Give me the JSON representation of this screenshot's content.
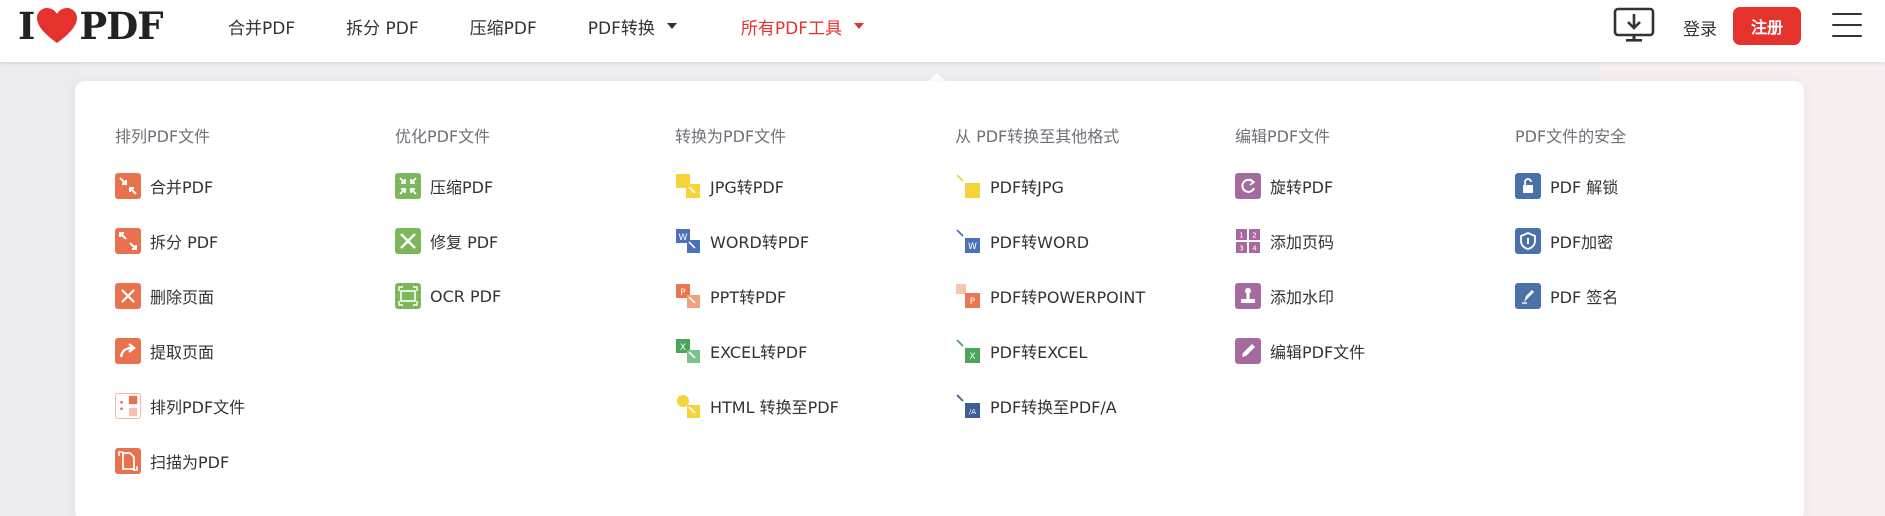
{
  "header": {
    "logo_left": "I",
    "logo_right": "PDF",
    "nav": [
      {
        "label": "合并PDF",
        "has_caret": false,
        "active": false
      },
      {
        "label": "拆分 PDF",
        "has_caret": false,
        "active": false
      },
      {
        "label": "压缩PDF",
        "has_caret": false,
        "active": false
      },
      {
        "label": "PDF转换",
        "has_caret": true,
        "active": false
      },
      {
        "label": "所有PDF工具",
        "has_caret": true,
        "active": true
      }
    ],
    "desktop_icon": "desktop-download-icon",
    "login": "登录",
    "signup": "注册",
    "menu_icon": "hamburger-icon"
  },
  "colors": {
    "accent": "#e5322d",
    "organize": "#e8724e",
    "optimize": "#7cb85b",
    "edit": "#a56a9e",
    "security": "#4b72a8"
  },
  "columns": [
    {
      "title": "排列PDF文件",
      "tools": [
        {
          "label": "合并PDF",
          "icon": "merge-icon"
        },
        {
          "label": "拆分 PDF",
          "icon": "split-icon"
        },
        {
          "label": "删除页面",
          "icon": "delete-pages-icon"
        },
        {
          "label": "提取页面",
          "icon": "extract-pages-icon"
        },
        {
          "label": "排列PDF文件",
          "icon": "organize-icon"
        },
        {
          "label": "扫描为PDF",
          "icon": "scan-icon"
        }
      ]
    },
    {
      "title": "优化PDF文件",
      "tools": [
        {
          "label": "压缩PDF",
          "icon": "compress-icon"
        },
        {
          "label": "修复 PDF",
          "icon": "repair-icon"
        },
        {
          "label": "OCR PDF",
          "icon": "ocr-icon"
        }
      ]
    },
    {
      "title": "转换为PDF文件",
      "tools": [
        {
          "label": "JPG转PDF",
          "icon": "jpg-to-pdf-icon"
        },
        {
          "label": "WORD转PDF",
          "icon": "word-to-pdf-icon"
        },
        {
          "label": "PPT转PDF",
          "icon": "ppt-to-pdf-icon"
        },
        {
          "label": "EXCEL转PDF",
          "icon": "excel-to-pdf-icon"
        },
        {
          "label": "HTML 转换至PDF",
          "icon": "html-to-pdf-icon"
        }
      ]
    },
    {
      "title": "从 PDF转换至其他格式",
      "tools": [
        {
          "label": "PDF转JPG",
          "icon": "pdf-to-jpg-icon"
        },
        {
          "label": "PDF转WORD",
          "icon": "pdf-to-word-icon"
        },
        {
          "label": "PDF转POWERPOINT",
          "icon": "pdf-to-ppt-icon"
        },
        {
          "label": "PDF转EXCEL",
          "icon": "pdf-to-excel-icon"
        },
        {
          "label": "PDF转换至PDF/A",
          "icon": "pdf-to-pdfa-icon"
        }
      ]
    },
    {
      "title": "编辑PDF文件",
      "tools": [
        {
          "label": "旋转PDF",
          "icon": "rotate-icon"
        },
        {
          "label": "添加页码",
          "icon": "page-numbers-icon"
        },
        {
          "label": "添加水印",
          "icon": "watermark-icon"
        },
        {
          "label": "编辑PDF文件",
          "icon": "edit-icon"
        }
      ]
    },
    {
      "title": "PDF文件的安全",
      "tools": [
        {
          "label": "PDF 解锁",
          "icon": "unlock-icon"
        },
        {
          "label": "PDF加密",
          "icon": "protect-icon"
        },
        {
          "label": "PDF 签名",
          "icon": "sign-icon"
        }
      ]
    }
  ]
}
